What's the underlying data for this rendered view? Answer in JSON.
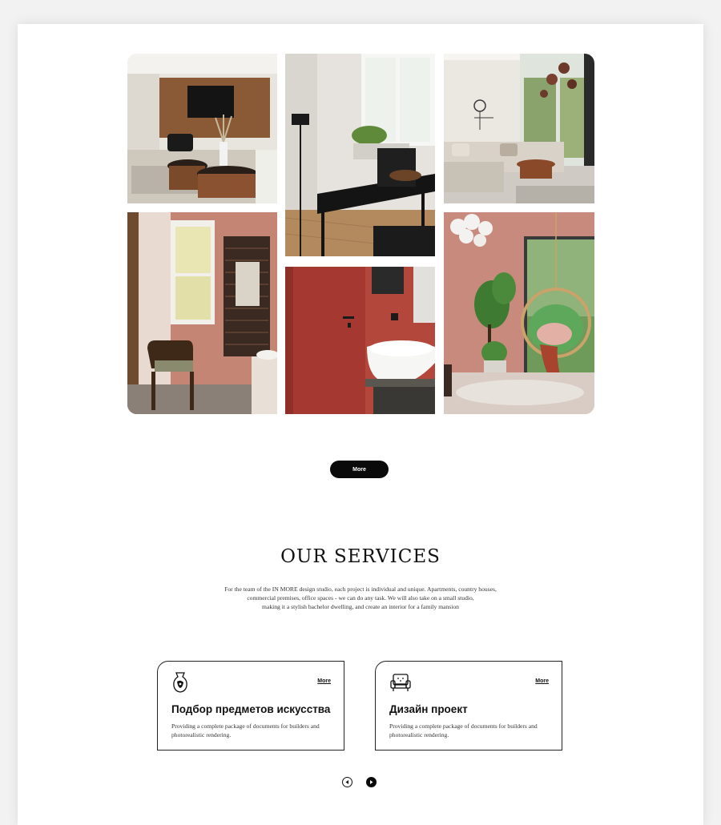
{
  "gallery": {
    "images": [
      {
        "name": "living-room-tv-wall"
      },
      {
        "name": "dining-table-window"
      },
      {
        "name": "lounge-sofa-pendants"
      },
      {
        "name": "bathroom-chair-radiator"
      },
      {
        "name": "red-door-washbasin"
      },
      {
        "name": "hanging-chair-plants"
      }
    ],
    "more_label": "More"
  },
  "services": {
    "title": "OUR SERVICES",
    "description_lines": [
      "For the team of the IN MORE design studio, each project is individual and unique. Apartments, country houses,",
      "commercial premises, office spaces - we can do any task. We will also take on a small studio,",
      "making it a stylish bachelor dwelling, and create an interior for a family mansion"
    ],
    "cards": [
      {
        "icon": "vase-icon",
        "title": "Подбор предметов искусства",
        "text": "Providing a complete package of documents for builders and photorealistic rendering.",
        "more": "More"
      },
      {
        "icon": "armchair-icon",
        "title": "Дизайн проект",
        "text": "Providing a complete package of documents for builders and photorealistic rendering.",
        "more": "More"
      }
    ]
  },
  "colors": {
    "accent": "#0a0a0a",
    "terracotta": "#c07a6e",
    "red_door": "#a83a32"
  }
}
